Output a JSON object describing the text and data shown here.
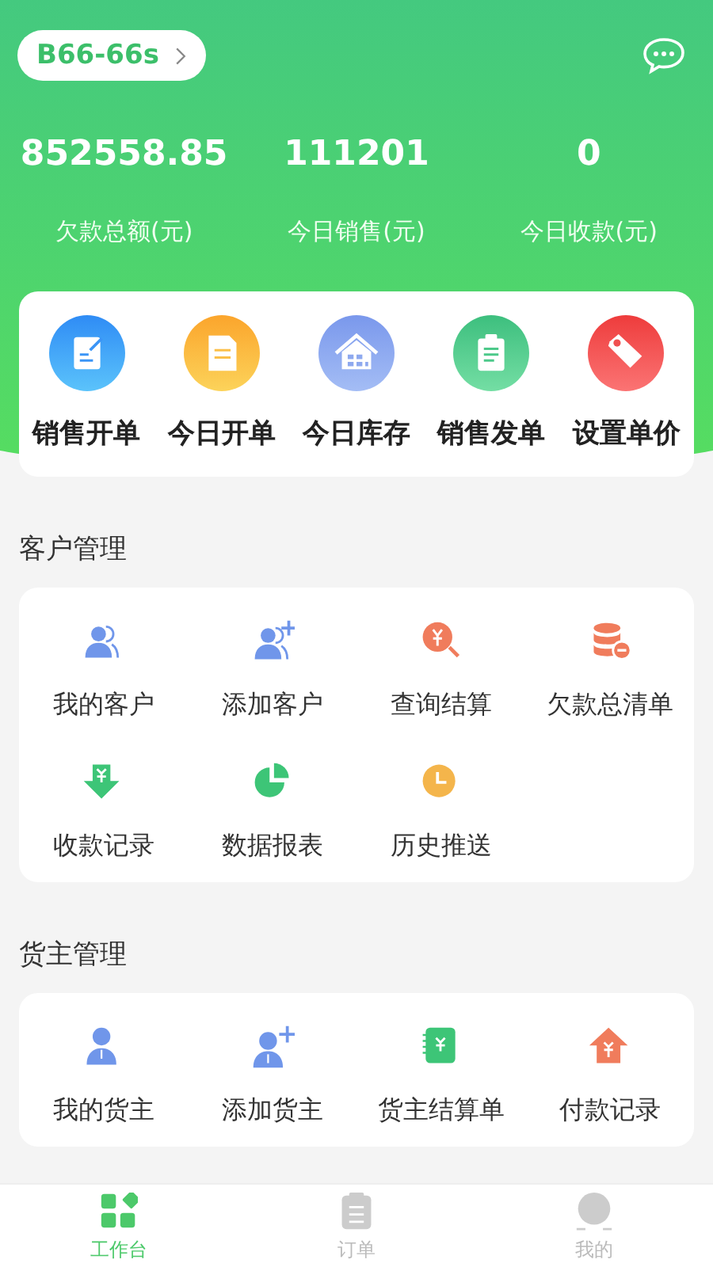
{
  "header": {
    "store": "B66-66s",
    "stats": [
      {
        "value": "852558.85",
        "label": "欠款总额(元)"
      },
      {
        "value": "111201",
        "label": "今日销售(元)"
      },
      {
        "value": "0",
        "label": "今日收款(元)"
      }
    ]
  },
  "quick_actions": [
    {
      "label": "销售开单",
      "kind": "edit"
    },
    {
      "label": "今日开单",
      "kind": "doc"
    },
    {
      "label": "今日库存",
      "kind": "house"
    },
    {
      "label": "销售发单",
      "kind": "clip"
    },
    {
      "label": "设置单价",
      "kind": "tag"
    }
  ],
  "sections": [
    {
      "title": "客户管理",
      "items": [
        {
          "label": "我的客户",
          "kind": "users"
        },
        {
          "label": "添加客户",
          "kind": "useradd"
        },
        {
          "label": "查询结算",
          "kind": "search"
        },
        {
          "label": "欠款总清单",
          "kind": "coins"
        },
        {
          "label": "收款记录",
          "kind": "down"
        },
        {
          "label": "数据报表",
          "kind": "pie"
        },
        {
          "label": "历史推送",
          "kind": "clock"
        }
      ]
    },
    {
      "title": "货主管理",
      "items": [
        {
          "label": "我的货主",
          "kind": "owner"
        },
        {
          "label": "添加货主",
          "kind": "owneradd"
        },
        {
          "label": "货主结算单",
          "kind": "book"
        },
        {
          "label": "付款记录",
          "kind": "home"
        }
      ]
    }
  ],
  "tabs": [
    {
      "label": "工作台",
      "kind": "grid",
      "selected": true
    },
    {
      "label": "订单",
      "kind": "clip",
      "selected": false
    },
    {
      "label": "我的",
      "kind": "person",
      "selected": false
    }
  ]
}
